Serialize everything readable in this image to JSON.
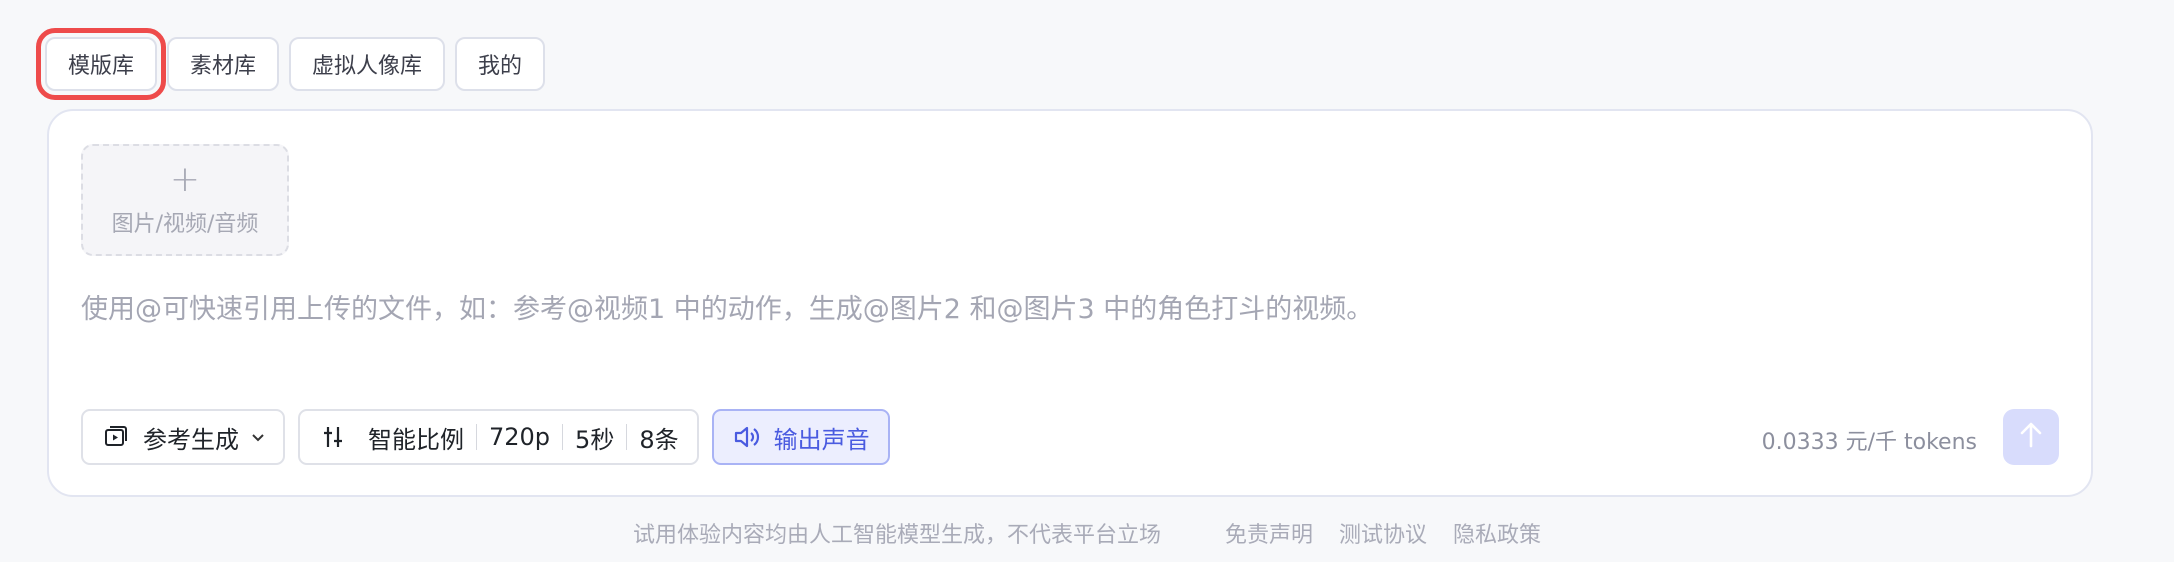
{
  "tabs": [
    {
      "label": "模版库",
      "active": true
    },
    {
      "label": "素材库"
    },
    {
      "label": "虚拟人像库"
    },
    {
      "label": "我的"
    }
  ],
  "upload": {
    "plus": "+",
    "label": "图片/视频/音频"
  },
  "prompt": {
    "placeholder": "使用@可快速引用上传的文件，如：参考@视频1 中的动作，生成@图片2 和@图片3 中的角色打斗的视频。",
    "value": ""
  },
  "toolbar": {
    "mode": {
      "label": "参考生成",
      "icon": "video-reference-icon"
    },
    "settings": {
      "icon": "sliders-icon",
      "ratio": "智能比例",
      "resolution": "720p",
      "duration": "5秒",
      "count": "8条"
    },
    "sound": {
      "label": "输出声音",
      "icon": "speaker-icon"
    }
  },
  "price": "0.0333 元/千 tokens",
  "send": {
    "icon": "arrow-up-icon"
  },
  "footer": {
    "disclaimer": "试用体验内容均由人工智能模型生成，不代表平台立场",
    "links": [
      "免责声明",
      "测试协议",
      "隐私政策"
    ]
  },
  "colors": {
    "accent": "#4a5be0",
    "highlight": "#ee4b4b",
    "send_bg": "#d8dcfc"
  }
}
